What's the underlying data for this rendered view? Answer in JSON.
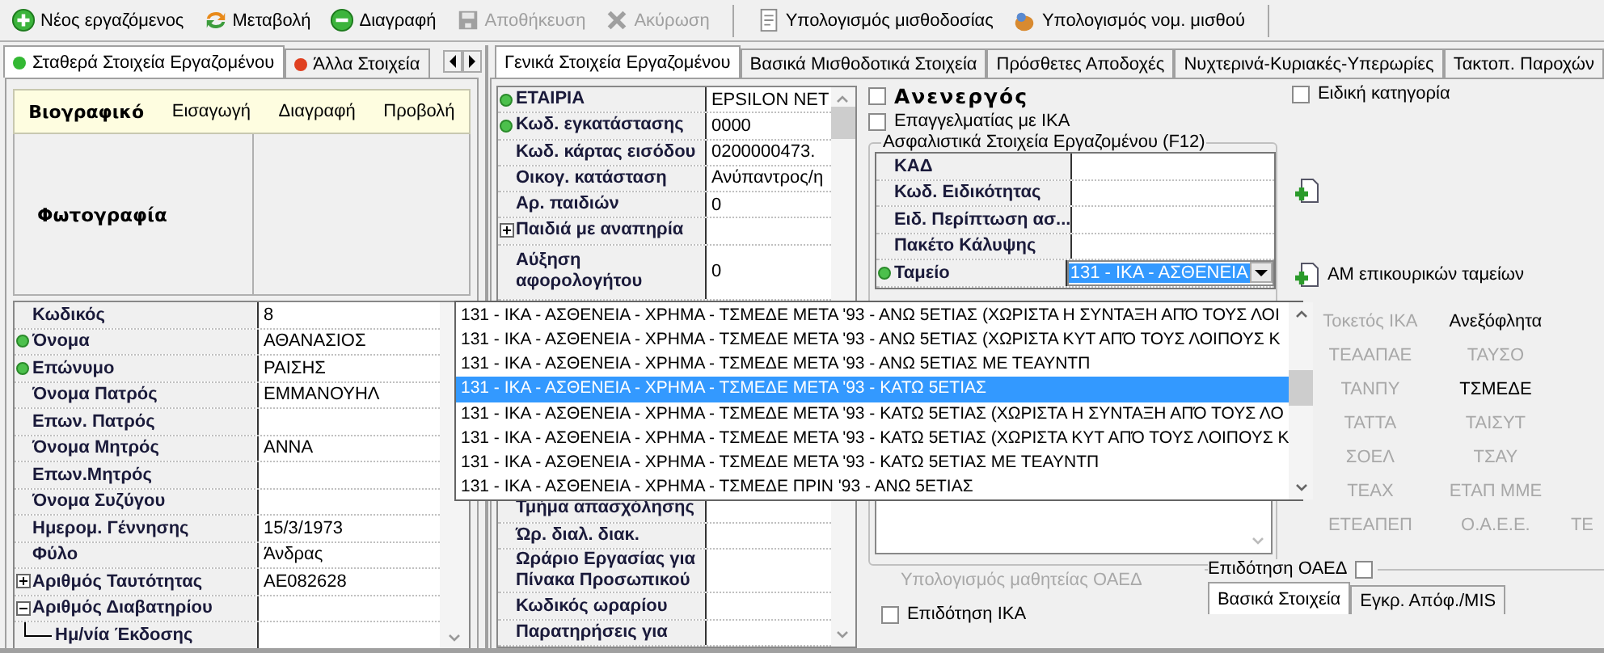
{
  "toolbar": [
    {
      "label": "Νέος εργαζόμενος",
      "disabled": false
    },
    {
      "label": "Μεταβολή",
      "disabled": false
    },
    {
      "label": "Διαγραφή",
      "disabled": false
    },
    {
      "label": "Αποθήκευση",
      "disabled": true
    },
    {
      "label": "Ακύρωση",
      "disabled": true
    },
    {
      "label": "Υπολογισμός μισθοδοσίας",
      "disabled": false
    },
    {
      "label": "Υπολογισμός νομ. μισθού",
      "disabled": false
    }
  ],
  "left_panel": {
    "tabs": [
      {
        "label": "Σταθερά Στοιχεία Εργαζομένου",
        "color": "#33b833",
        "selected": true
      },
      {
        "label": "Άλλα Στοιχεία",
        "color": "#e04020",
        "selected": false
      }
    ],
    "biography_menu": [
      {
        "label": "Βιογραφικό",
        "selected": true
      },
      {
        "label": "Εισαγωγή",
        "selected": false
      },
      {
        "label": "Διαγραφή",
        "selected": false
      },
      {
        "label": "Προβολή",
        "selected": false
      }
    ],
    "photo_label": "Φωτογραφία",
    "rows": [
      {
        "label": "Κωδικός",
        "value": "8",
        "kind": "field"
      },
      {
        "label": "Όνομα",
        "value": "ΑΘΑΝΑΣΙΟΣ",
        "kind": "required"
      },
      {
        "label": "Επώνυμο",
        "value": "ΡΑΙΣΗΣ",
        "kind": "required"
      },
      {
        "label": "Όνομα Πατρός",
        "value": "ΕΜΜΑΝΟΥΗΛ",
        "kind": "field"
      },
      {
        "label": "Επων. Πατρός",
        "kind": "field"
      },
      {
        "label": "Όνομα Μητρός",
        "value": "ΑΝΝΑ",
        "kind": "field"
      },
      {
        "label": "Επων.Μητρός",
        "kind": "field"
      },
      {
        "label": "Όνομα Συζύγου",
        "kind": "field"
      },
      {
        "label": "Ημερομ. Γέννησης",
        "value": "15/3/1973",
        "kind": "field"
      },
      {
        "label": "Φύλο",
        "value": "Άνδρας",
        "kind": "field"
      },
      {
        "label": "Αριθμός Ταυτότητας",
        "value": "ΑΕ082628",
        "kind": "collapsed"
      },
      {
        "label": "Αριθμός Διαβατηρίου",
        "kind": "expanded"
      },
      {
        "label": "Ημ/νία Έκδοσης",
        "kind": "child"
      }
    ]
  },
  "main_tabs": [
    {
      "label": "Γενικά Στοιχεία Εργαζομένου",
      "selected": true
    },
    {
      "label": "Βασικά Μισθοδοτικά Στοιχεία",
      "selected": false
    },
    {
      "label": "Πρόσθετες Αποδοχές",
      "selected": false
    },
    {
      "label": "Νυχτερινά-Κυριακές-Υπερωρίες",
      "selected": false
    },
    {
      "label": "Τακτοπ. Παροχών",
      "selected": false
    }
  ],
  "general_grid": {
    "rows_top": [
      {
        "label": "ΕΤΑΙΡΙΑ",
        "value": "EPSILON NET",
        "kind": "required"
      },
      {
        "label": "Κωδ. εγκατάστασης",
        "value": "0000",
        "kind": "required"
      },
      {
        "label": "Κωδ. κάρτας εισόδου",
        "value": "0200000473.",
        "kind": "field"
      },
      {
        "label": "Οικογ. κατάσταση",
        "value": "Ανύπαντρος/η",
        "kind": "field"
      },
      {
        "label": "Αρ. παιδιών",
        "value": "0",
        "kind": "field"
      },
      {
        "label": "Παιδιά με αναπηρία",
        "kind": "collapsed"
      },
      {
        "label": "Αύξηση αφορολογήτου",
        "value": "0",
        "kind": "field"
      }
    ],
    "rows_bottom": [
      {
        "label": "Τμήμα απασχόλησης"
      },
      {
        "label": "Ώρ. διαλ. διακ."
      },
      {
        "label": "Ωράριο Εργασίας για Πίνακα Προσωπικού"
      },
      {
        "label": "Κωδικός ωραρίου"
      },
      {
        "label": "Παρατηρήσεις για"
      }
    ]
  },
  "inactive": {
    "label": "Ανενεργός",
    "checked": false
  },
  "professional_ika": {
    "label": "Επαγγελματίας με ΙΚΑ",
    "checked": false
  },
  "special_category": {
    "label": "Ειδική κατηγορία",
    "checked": false
  },
  "insurance_group": {
    "title": "Ασφαλιστικά Στοιχεία Εργαζομένου (F12)",
    "rows": [
      {
        "label": "ΚΑΔ"
      },
      {
        "label": "Κωδ. Ειδικότητας"
      },
      {
        "label": "Ειδ. Περίπτωση ασ..."
      },
      {
        "label": "Πακέτο Κάλυψης"
      }
    ],
    "fund": {
      "label": "Ταμείο",
      "value": "131 - ΙΚΑ - ΑΣΘΕΝΕΙΑ"
    }
  },
  "aux_funds_button": "ΑΜ επικουρικών ταμείων",
  "fund_dropdown": [
    {
      "label": "131 - ΙΚΑ - ΑΣΘΕΝΕΙΑ - ΧΡΗΜΑ - ΤΣΜΕΔΕ ΜΕΤΑ '93 - ΑΝΩ 5ΕΤΙΑΣ (ΧΩΡΙΣΤΑ Η ΣΥΝΤΑΞΗ ΑΠΌ ΤΟΥΣ ΛΟΙ",
      "selected": false
    },
    {
      "label": "131 - ΙΚΑ - ΑΣΘΕΝΕΙΑ - ΧΡΗΜΑ - ΤΣΜΕΔΕ ΜΕΤΑ '93 - ΑΝΩ 5ΕΤΙΑΣ (ΧΩΡΙΣΤΑ ΚΥΤ ΑΠΌ ΤΟΥΣ ΛΟΙΠΟΥΣ Κ",
      "selected": false
    },
    {
      "label": "131 - ΙΚΑ - ΑΣΘΕΝΕΙΑ - ΧΡΗΜΑ - ΤΣΜΕΔΕ ΜΕΤΑ '93 - ΑΝΩ 5ΕΤΙΑΣ ΜΕ ΤΕΑΥΝΤΠ",
      "selected": false
    },
    {
      "label": "131 - ΙΚΑ - ΑΣΘΕΝΕΙΑ - ΧΡΗΜΑ - ΤΣΜΕΔΕ ΜΕΤΑ '93 - ΚΑΤΩ 5ΕΤΙΑΣ",
      "selected": true
    },
    {
      "label": "131 - ΙΚΑ - ΑΣΘΕΝΕΙΑ - ΧΡΗΜΑ - ΤΣΜΕΔΕ ΜΕΤΑ '93 - ΚΑΤΩ 5ΕΤΙΑΣ (ΧΩΡΙΣΤΑ Η ΣΥΝΤΑΞΗ ΑΠΌ ΤΟΥΣ ΛΟ",
      "selected": false
    },
    {
      "label": "131 - ΙΚΑ - ΑΣΘΕΝΕΙΑ - ΧΡΗΜΑ - ΤΣΜΕΔΕ ΜΕΤΑ '93 - ΚΑΤΩ 5ΕΤΙΑΣ (ΧΩΡΙΣΤΑ ΚΥΤ ΑΠΌ ΤΟΥΣ ΛΟΙΠΟΥΣ Κ",
      "selected": false
    },
    {
      "label": "131 - ΙΚΑ - ΑΣΘΕΝΕΙΑ - ΧΡΗΜΑ - ΤΣΜΕΔΕ ΜΕΤΑ '93 - ΚΑΤΩ 5ΕΤΙΑΣ ΜΕ ΤΕΑΥΝΤΠ",
      "selected": false
    },
    {
      "label": "131 - ΙΚΑ - ΑΣΘΕΝΕΙΑ - ΧΡΗΜΑ - ΤΣΜΕΔΕ ΠΡΙΝ '93 - ΑΝΩ 5ΕΤΙΑΣ",
      "selected": false
    }
  ],
  "fund_links": [
    [
      {
        "label": "Τοκετός ΙΚΑ",
        "disabled": true
      },
      {
        "label": "Ανεξόφλητα",
        "disabled": false
      }
    ],
    [
      {
        "label": "ΤΕΑΑΠΑΕ",
        "disabled": true
      },
      {
        "label": "ΤΑΥΣΟ",
        "disabled": true
      }
    ],
    [
      {
        "label": "ΤΑΝΠΥ",
        "disabled": true
      },
      {
        "label": "ΤΣΜΕΔΕ",
        "disabled": false
      }
    ],
    [
      {
        "label": "ΤΑΤΤΑ",
        "disabled": true
      },
      {
        "label": "ΤΑΙΣΥΤ",
        "disabled": true
      }
    ],
    [
      {
        "label": "ΣΟΕΛ",
        "disabled": true
      },
      {
        "label": "ΤΣΑΥ",
        "disabled": true
      }
    ],
    [
      {
        "label": "ΤΕΑΧ",
        "disabled": true
      },
      {
        "label": "ΕΤΑΠ ΜΜΕ",
        "disabled": true
      }
    ],
    [
      {
        "label": "ΕΤΕΑΠΕΠ",
        "disabled": true
      },
      {
        "label": "Ο.Α.Ε.Ε.",
        "disabled": true
      },
      {
        "label": "ΤΕ",
        "disabled": true
      }
    ]
  ],
  "oaed_apprenticeship": {
    "label": "Υπολογισμός μαθητείας ΟΑΕΔ",
    "disabled": true
  },
  "ika_subsidy": {
    "label": "Επιδότηση ΙΚΑ",
    "checked": false
  },
  "oaed_subsidy": {
    "label": "Επιδότηση ΟΑΕΔ",
    "checked": false,
    "tabs": [
      {
        "label": "Βασικά Στοιχεία",
        "selected": true
      },
      {
        "label": "Εγκρ. Απόφ./MIS",
        "selected": false
      }
    ]
  }
}
